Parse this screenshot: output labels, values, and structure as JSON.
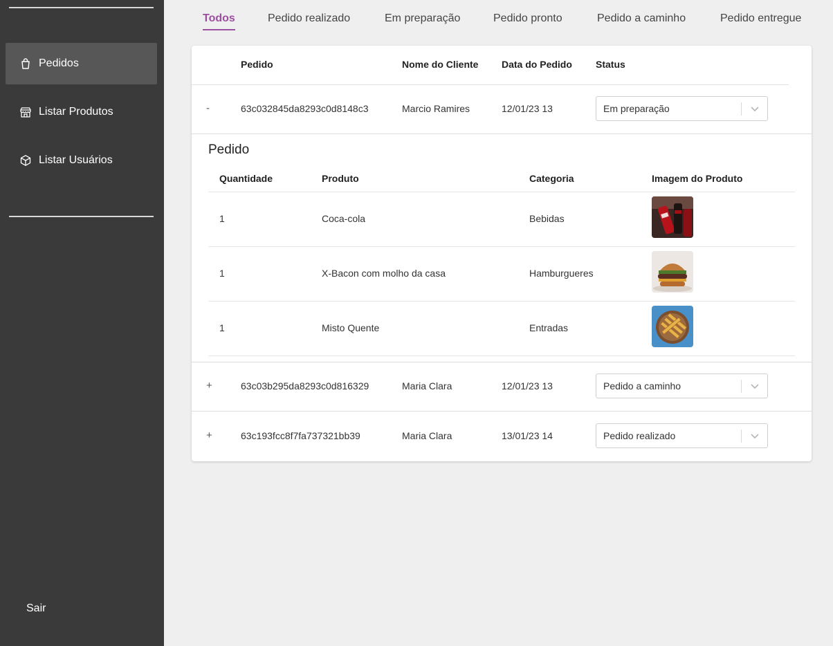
{
  "sidebar": {
    "items": [
      {
        "label": "Pedidos",
        "icon": "shopping-bag-icon",
        "active": true
      },
      {
        "label": "Listar Produtos",
        "icon": "store-icon",
        "active": false
      },
      {
        "label": "Listar Usuários",
        "icon": "box-icon",
        "active": false
      }
    ],
    "logout_label": "Sair"
  },
  "tabs": [
    "Todos",
    "Pedido realizado",
    "Em preparação",
    "Pedido pronto",
    "Pedido a caminho",
    "Pedido entregue"
  ],
  "active_tab": "Todos",
  "accent_color": "#9b4fa0",
  "table": {
    "headers": [
      "Pedido",
      "Nome do Cliente",
      "Data do Pedido",
      "Status"
    ],
    "rows": [
      {
        "toggle": "-",
        "id": "63c032845da8293c0d8148c3",
        "client": "Marcio Ramires",
        "date": "12/01/23 13",
        "status": "Em preparação"
      },
      {
        "toggle": "+",
        "id": "63c03b295da8293c0d816329",
        "client": "Maria Clara",
        "date": "12/01/23 13",
        "status": "Pedido a caminho"
      },
      {
        "toggle": "+",
        "id": "63c193fcc8f7fa737321bb39",
        "client": "Maria Clara",
        "date": "13/01/23 14",
        "status": "Pedido realizado"
      }
    ]
  },
  "detail": {
    "title": "Pedido",
    "headers": [
      "Quantidade",
      "Produto",
      "Categoria",
      "Imagem do Produto"
    ],
    "items": [
      {
        "qty": "1",
        "product": "Coca-cola",
        "category": "Bebidas"
      },
      {
        "qty": "1",
        "product": "X-Bacon com molho da casa",
        "category": "Hamburgueres"
      },
      {
        "qty": "1",
        "product": "Misto Quente",
        "category": "Entradas"
      }
    ]
  }
}
